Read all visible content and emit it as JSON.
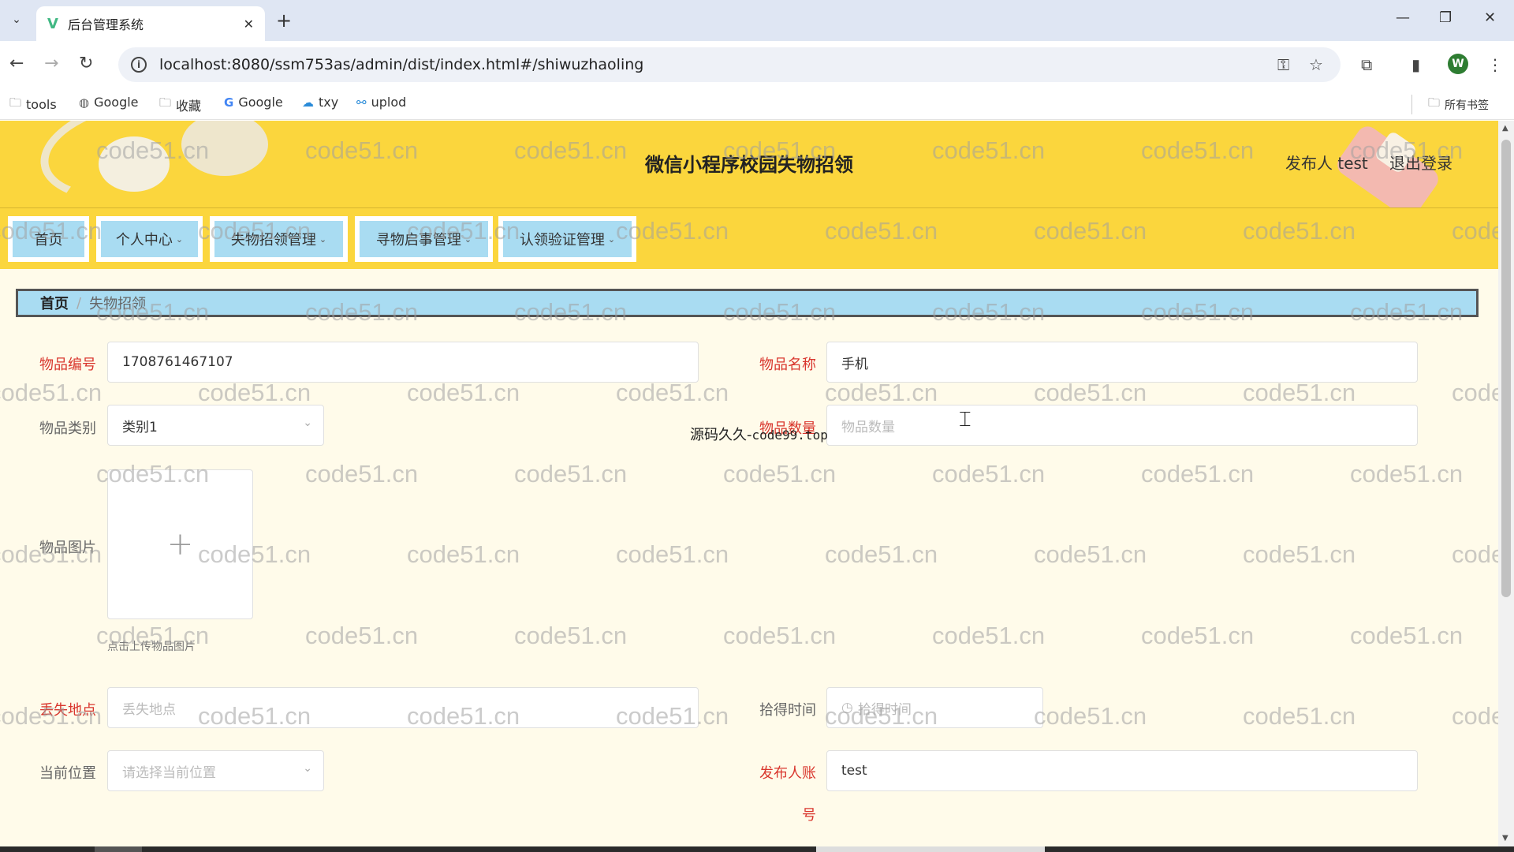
{
  "browser": {
    "tab_title": "后台管理系统",
    "tab_close": "✕",
    "new_tab": "+",
    "url": "localhost:8080/ssm753as/admin/dist/index.html#/shiwuzhaoling",
    "bookmarks": [
      {
        "label": "tools",
        "icon": "folder-icon"
      },
      {
        "label": "Google",
        "icon": "globe-icon"
      },
      {
        "label": "收藏",
        "icon": "folder-icon"
      },
      {
        "label": "Google",
        "icon": "google-icon"
      },
      {
        "label": "txy",
        "icon": "cloud-icon"
      },
      {
        "label": "uplod",
        "icon": "share-icon"
      }
    ],
    "all_bookmarks": "所有书签",
    "profile_initial": "W"
  },
  "header": {
    "site_title": "微信小程序校园失物招领",
    "user_info": "发布人 test",
    "logout": "退出登录"
  },
  "nav": {
    "items": [
      {
        "label": "首页",
        "dropdown": false
      },
      {
        "label": "个人中心",
        "dropdown": true
      },
      {
        "label": "失物招领管理",
        "dropdown": true
      },
      {
        "label": "寻物启事管理",
        "dropdown": true
      },
      {
        "label": "认领验证管理",
        "dropdown": true
      }
    ]
  },
  "breadcrumb": {
    "home": "首页",
    "separator": "/",
    "current": "失物招领"
  },
  "form": {
    "item_no": {
      "label": "物品编号",
      "value": "1708761467107"
    },
    "item_name": {
      "label": "物品名称",
      "value": "手机"
    },
    "category": {
      "label": "物品类别",
      "value": "类别1"
    },
    "quantity": {
      "label": "物品数量",
      "placeholder": "物品数量"
    },
    "image": {
      "label": "物品图片",
      "hint": "点击上传物品图片"
    },
    "lost_place": {
      "label": "丢失地点",
      "placeholder": "丢失地点"
    },
    "found_time": {
      "label": "拾得时间",
      "placeholder": "拾得时间"
    },
    "current_location": {
      "label": "当前位置",
      "placeholder": "请选择当前位置"
    },
    "publisher_account": {
      "label_line1": "发布人账",
      "label_line2": "号",
      "value": "test"
    }
  },
  "overlay": {
    "text_cn": "源码久久-",
    "text_mono": "code99.top"
  },
  "watermark": "code51.cn",
  "colors": {
    "header_bg": "#fbd63d",
    "menu_bg": "#a9dcf2",
    "required_label": "#d9362d",
    "page_bg": "#fffbea"
  }
}
